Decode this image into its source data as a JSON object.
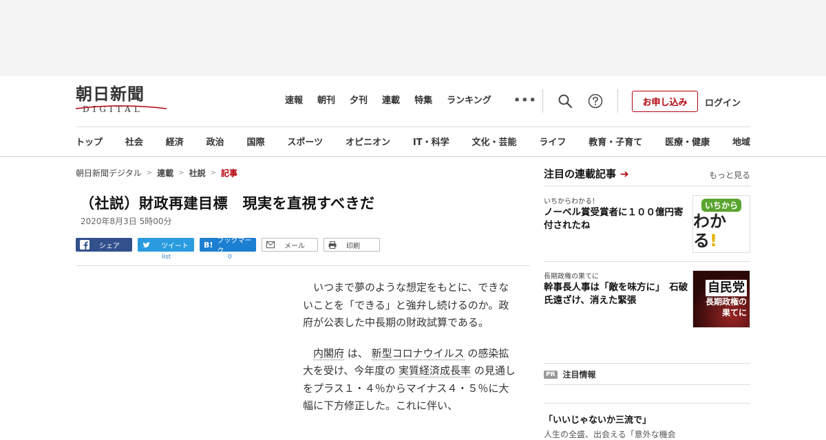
{
  "header": {
    "logo_jp": "朝日新聞",
    "logo_en": "DIGITAL",
    "top_nav": [
      "速報",
      "朝刊",
      "夕刊",
      "連載",
      "特集",
      "ランキング"
    ],
    "more": "•••",
    "apply_label": "お申し込み",
    "login_label": "ログイン",
    "categories": [
      "トップ",
      "社会",
      "経済",
      "政治",
      "国際",
      "スポーツ",
      "オピニオン",
      "IT・科学",
      "文化・芸能",
      "ライフ",
      "教育・子育て",
      "医療・健康",
      "地域"
    ]
  },
  "breadcrumb": {
    "items": [
      "朝日新聞デジタル",
      "連載",
      "社説",
      "記事"
    ],
    "separator": ">"
  },
  "article": {
    "headline": "（社説）財政再建目標　現実を直視すべきだ",
    "date": "2020年8月3日 5時00分",
    "share": {
      "facebook": "シェア",
      "twitter": "ツイート",
      "twitter_count": "list",
      "hatena_mark": "B!",
      "hatena": "ブックマーク",
      "hatena_count": "0",
      "mail": "メール",
      "print": "印刷"
    },
    "paragraph1": "いつまで夢のような想定をもとに、できないことを「できる」と強弁し続けるのか。政府が公表した中長期の財政試算である。",
    "p2": {
      "kw1": "内閣府",
      "t1": " は、 ",
      "kw2": "新型コロナウイルス",
      "t2": " の感染拡大を受け、今年度の ",
      "kw3": "実質経済成長率",
      "t3": " の見通しをプラス１・４％からマイナス４・５％に大幅に下方修正した。これに伴い、"
    }
  },
  "sidebar": {
    "title": "注目の連載記事",
    "arrow": "➔",
    "more": "もっと見る",
    "cards": [
      {
        "kicker": "いちからわかる！",
        "title": "ノーベル賞受賞者に１００億円寄付されたね",
        "thumb_top": "いちから",
        "thumb_main": "わかる",
        "thumb_ex": "!"
      },
      {
        "kicker": "長期政権の果てに",
        "title": "幹事長人事は「敵を味方に」　石破氏遠ざけ、消えた緊張",
        "thumb_top": "自民党",
        "thumb_main": "長期政権の",
        "thumb_sub": "果てに"
      }
    ],
    "pr_badge": "PR",
    "pr_title": "注目情報",
    "pr_item_title": "「いいじゃないか三流で」",
    "pr_item_sub": "人生の全盛、出会える「意外な機会"
  },
  "colors": {
    "accent_red": "#b3000c",
    "facebook": "#32508c",
    "twitter": "#2b9be0",
    "hatena": "#1c7fd1"
  }
}
